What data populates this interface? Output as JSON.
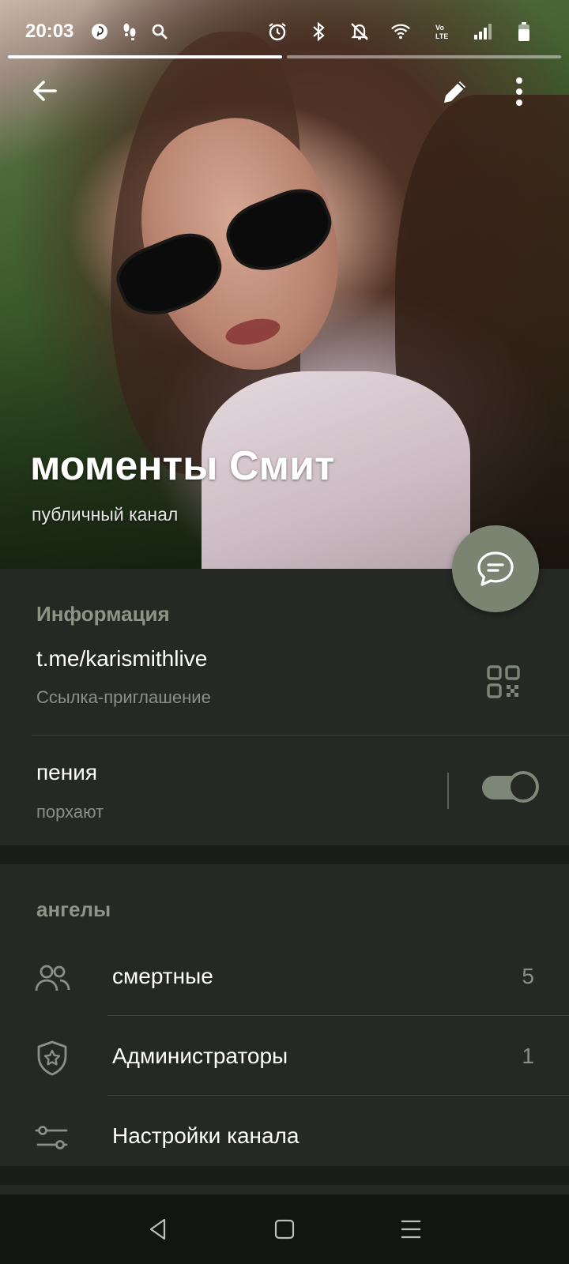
{
  "status_bar": {
    "time": "20:03",
    "icons_left": [
      "pinterest-icon",
      "footsteps-icon",
      "search-icon"
    ],
    "icons_right": [
      "alarm-icon",
      "bluetooth-icon",
      "notifications-off-icon",
      "wifi-icon",
      "volte-icon",
      "signal-icon",
      "battery-icon"
    ]
  },
  "story": {
    "segments": 2,
    "active_index": 0
  },
  "channel": {
    "title": "моменты Смит",
    "subtitle": "публичный канал"
  },
  "info": {
    "header": "Информация",
    "link": "t.me/karismithlive",
    "link_caption": "Ссылка-приглашение",
    "toggle_title": "пения",
    "toggle_subtitle": "порхают",
    "toggle_on": true
  },
  "angels": {
    "header": "ангелы",
    "rows": [
      {
        "label": "смертные",
        "count": "5",
        "icon": "people-icon"
      },
      {
        "label": "Администраторы",
        "count": "1",
        "icon": "admin-shield-icon"
      },
      {
        "label": "Настройки канала",
        "count": "",
        "icon": "settings-sliders-icon"
      }
    ]
  },
  "colors": {
    "accent": "#7a8470",
    "section_bg": "#262823",
    "section_header": "#8d9585",
    "secondary_text": "#8a8f87"
  },
  "nav": [
    "back-nav-icon",
    "home-nav-icon",
    "recents-nav-icon"
  ]
}
